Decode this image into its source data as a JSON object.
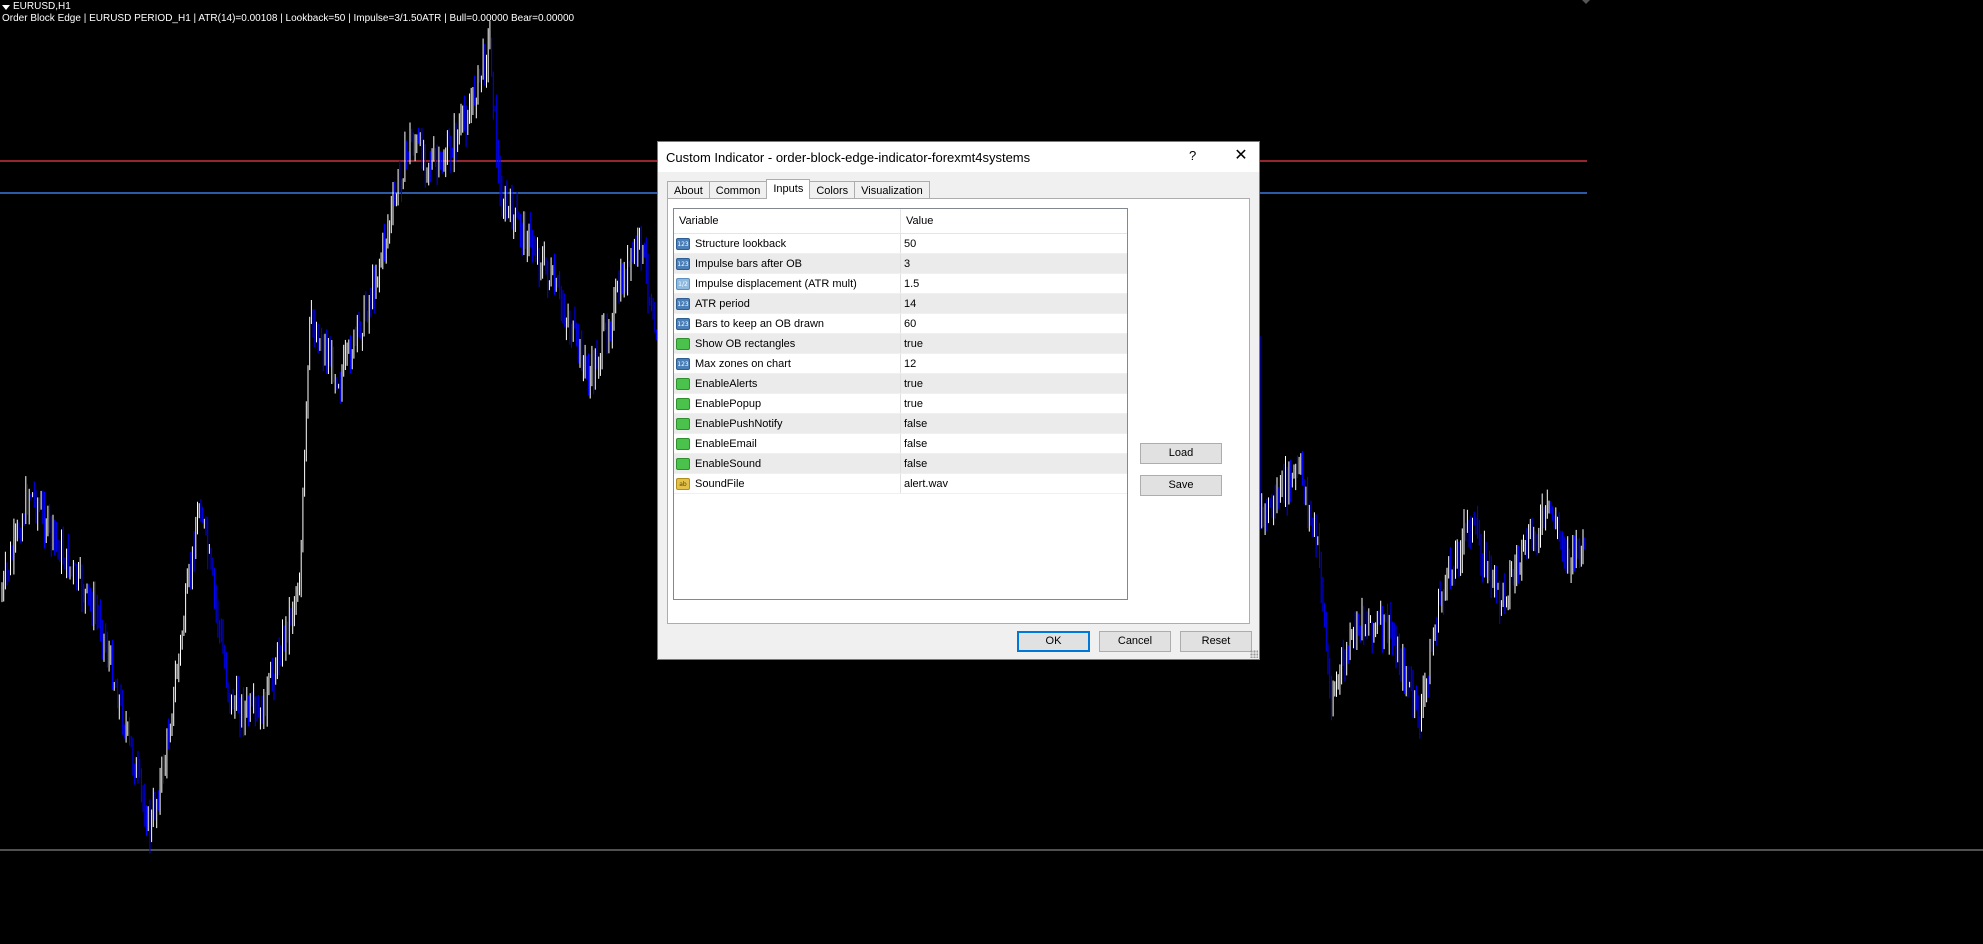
{
  "chart": {
    "symbol": "EURUSD,H1",
    "info_line": "Order Block Edge | EURUSD PERIOD_H1 | ATR(14)=0.00108 | Lookback=50 | Impulse=3/1.50ATR | Bull=0.00000 Bear=0.00000",
    "colors": {
      "background": "#000000",
      "bull_candle": "#ffffff",
      "bear_candle": "#0000ff",
      "resistance_line": "#c8323c",
      "support_line": "#3c78dc",
      "bid_line": "#a0a0a0"
    }
  },
  "dialog": {
    "title": "Custom Indicator - order-block-edge-indicator-forexmt4systems",
    "help": "?",
    "close_icon": "close-icon",
    "tabs": [
      {
        "label": "About",
        "active": false
      },
      {
        "label": "Common",
        "active": false
      },
      {
        "label": "Inputs",
        "active": true
      },
      {
        "label": "Colors",
        "active": false
      },
      {
        "label": "Visualization",
        "active": false
      }
    ],
    "grid": {
      "col_variable": "Variable",
      "col_value": "Value",
      "rows": [
        {
          "icon": "int-icon",
          "icon_text": "123",
          "variable": "Structure lookback",
          "value": "50"
        },
        {
          "icon": "int-icon",
          "icon_text": "123",
          "variable": "Impulse bars after OB",
          "value": "3"
        },
        {
          "icon": "double-icon",
          "icon_text": "1/2",
          "variable": "Impulse displacement (ATR mult)",
          "value": "1.5"
        },
        {
          "icon": "int-icon",
          "icon_text": "123",
          "variable": "ATR period",
          "value": "14"
        },
        {
          "icon": "int-icon",
          "icon_text": "123",
          "variable": "Bars to keep an OB drawn",
          "value": "60"
        },
        {
          "icon": "bool-icon",
          "icon_text": "",
          "variable": "Show OB rectangles",
          "value": "true"
        },
        {
          "icon": "int-icon",
          "icon_text": "123",
          "variable": "Max zones on chart",
          "value": "12"
        },
        {
          "icon": "bool-icon",
          "icon_text": "",
          "variable": "EnableAlerts",
          "value": "true"
        },
        {
          "icon": "bool-icon",
          "icon_text": "",
          "variable": "EnablePopup",
          "value": "true"
        },
        {
          "icon": "bool-icon",
          "icon_text": "",
          "variable": "EnablePushNotify",
          "value": "false"
        },
        {
          "icon": "bool-icon",
          "icon_text": "",
          "variable": "EnableEmail",
          "value": "false"
        },
        {
          "icon": "bool-icon",
          "icon_text": "",
          "variable": "EnableSound",
          "value": "false"
        },
        {
          "icon": "string-icon",
          "icon_text": "ab",
          "variable": "SoundFile",
          "value": "alert.wav"
        }
      ]
    },
    "buttons": {
      "load": "Load",
      "save": "Save",
      "ok": "OK",
      "cancel": "Cancel",
      "reset": "Reset"
    }
  }
}
